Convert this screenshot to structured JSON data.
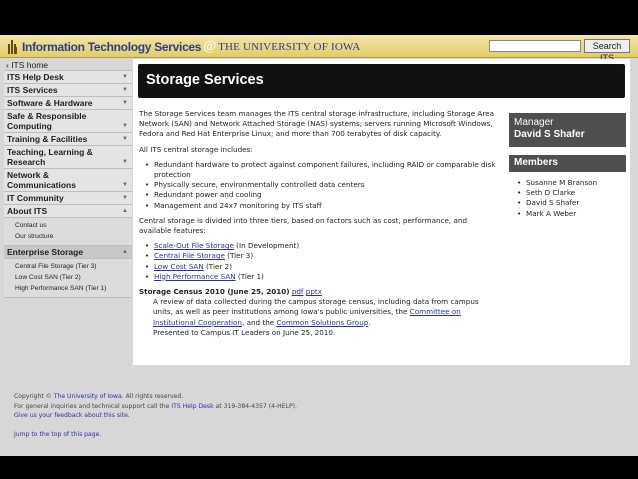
{
  "header": {
    "logo_its": "Information Technology Services",
    "logo_at": "@",
    "logo_ui": "THE UNIVERSITY OF IOWA",
    "search_value": "",
    "search_button": "Search ITS"
  },
  "sidebar": {
    "home": "‹ ITS home",
    "items": [
      "ITS Help Desk",
      "ITS Services",
      "Software & Hardware",
      "Safe & Responsible Computing",
      "Training & Facilities",
      "Teaching, Learning & Research",
      "Network & Communications",
      "IT Community",
      "About ITS"
    ],
    "about_sub": [
      "Contact us",
      "Our structure"
    ],
    "enterprise": "Enterprise Storage",
    "enterprise_sub": [
      "Central File Storage (Tier 3)",
      "Low Cost SAN (Tier 2)",
      "High Performance SAN (Tier 1)"
    ]
  },
  "main": {
    "title": "Storage Services",
    "intro": "The Storage Services team manages the ITS central storage infrastructure, including Storage Area Network (SAN) and Network Attached Storage (NAS) systems; servers running Microsoft Windows, Fedora and Red Hat Enterprise Linux; and more than 700 terabytes of disk capacity.",
    "includes_label": "All ITS central storage includes:",
    "includes": [
      "Redundant hardware to protect against component failures, including RAID or comparable disk protection",
      "Physically secure, environmentally controlled data centers",
      "Redundant power and cooling",
      "Management and 24x7 monitoring by ITS staff"
    ],
    "tiers_intro": "Central storage is divided into three tiers, based on factors such as cost, performance, and available features:",
    "tiers": [
      {
        "link": "Scale-Out File Storage",
        "note": " (In Development)"
      },
      {
        "link": "Central File Storage",
        "note": " (Tier 3)"
      },
      {
        "link": "Low Cost SAN",
        "note": " (Tier 2)"
      },
      {
        "link": "High Performance SAN",
        "note": " (Tier 1)"
      }
    ],
    "census_title": "Storage Census 2010 (June 25, 2010)",
    "census_pdf": "pdf",
    "census_pptx": "pptx",
    "census_text_1": "A review of data collected during the campus storage census, including data from campus units, as well as peer institutions among Iowa's public universities, the",
    "census_link_1": "Committee on Institutional Cooperation",
    "census_text_2": ", and the",
    "census_link_2": "Common Solutions Group",
    "census_text_3": ".",
    "census_text_4": "Presented to Campus IT Leaders on June 25, 2010.",
    "manager_label": "Manager",
    "manager_name": "David S Shafer",
    "members_title": "Members",
    "members": [
      "Susanne M Branson",
      "Seth D Clarke",
      "David S Shafer",
      "Mark A Weber"
    ]
  },
  "footer": {
    "copyright_pre": "Copyright ©",
    "copyright_link": "The University of Iowa",
    "copyright_post": ". All rights reserved.",
    "inquiries_pre": "For general inquiries and technical support call the",
    "inquiries_link": "ITS Help Desk",
    "inquiries_post": "at 319-384-4357 (4-HELP).",
    "feedback": "Give us your feedback about this site.",
    "jump": "Jump to the top of this page."
  }
}
